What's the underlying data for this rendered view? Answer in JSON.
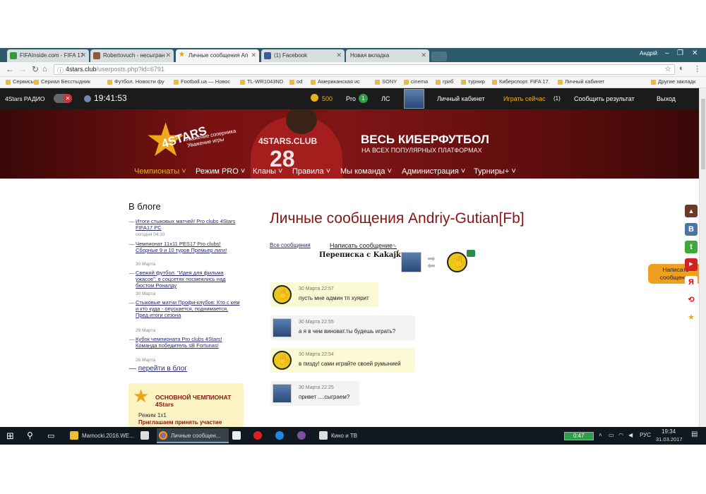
{
  "browser": {
    "tabs": [
      {
        "label": "FIFAInside.com - FIFA 17",
        "active": false
      },
      {
        "label": "Robertovuch - несыгран",
        "active": false
      },
      {
        "label": "Личные сообщения Ап",
        "active": true
      },
      {
        "label": "(1) Facebook",
        "active": false
      },
      {
        "label": "Новая вкладка",
        "active": false
      }
    ],
    "profile": "Андрій",
    "url_host": "4stars.club",
    "url_path": "/userposts.php?id=6791",
    "bookmarks": [
      "Сервисы",
      "Сериал Бесстыдник",
      "Футбол. Новости фу",
      "Football.ua — Новос",
      "TL-WR1043ND",
      "od",
      "Американская ис",
      "SONY",
      "cinema",
      "гриб",
      "турнир",
      "Киберспорт. FIFA 17.",
      "Личный кабинет",
      "Другие закладк"
    ]
  },
  "sitebar": {
    "radio": "4Stars РАДИО",
    "time": "19:41:53",
    "coins": "500",
    "pro_label": "Pro",
    "pro_count": "1",
    "ls": "ЛС",
    "cabinet": "Личный кабинет",
    "play_now": "Играть сейчас",
    "play_now_count": "(1)",
    "report": "Сообщить результат",
    "exit": "Выход"
  },
  "hero": {
    "logo_text": "4STARS",
    "logo_sub1": "Уважение соперника",
    "logo_sub2": "Уважение игры",
    "jersey_text": "4STARS.CLUB",
    "jersey_number": "28",
    "headline": "ВЕСЬ КИБЕРФУТБОЛ",
    "subheadline": "НА ВСЕХ ПОПУЛЯРНЫХ ПЛАТФОРМАХ"
  },
  "menu": [
    {
      "label": "Чемпионаты",
      "active": true
    },
    {
      "label": "Режим PRO",
      "active": false
    },
    {
      "label": "Кланы",
      "active": false
    },
    {
      "label": "Правила",
      "active": false
    },
    {
      "label": "Мы команда",
      "active": false
    },
    {
      "label": "Администрация",
      "active": false
    },
    {
      "label": "Турниры+",
      "active": false
    }
  ],
  "sidebar": {
    "title": "В блоге",
    "items": [
      {
        "title": "Итоги стыковых матчей! Pro clubs 4Stars FIFA17 PC",
        "date": "сегодня 04:10"
      },
      {
        "title": "Чемпионат 11х11 PES17 Pro clubs! Сборные 9 и 10 туров Премьер лиги!",
        "date": "30 Марта"
      },
      {
        "title": "Свежий футбол. \"Идея для фильма ужасов\": в соцсетях посмеялись над бюстом Роналду",
        "date": "30 Марта"
      },
      {
        "title": "Стыковые матчи Профи-клубов: Кто с кем и кто куда - опускается, поднимается. Пред итоги сезона",
        "date": "29 Марта"
      },
      {
        "title": "Кубок чемпионата Pro clubs 4Stars! Команда победитель sB Fortunas!",
        "date": "26 Марта"
      }
    ],
    "more": "перейти в блог",
    "champ_title": "ОСНОВНОЙ ЧЕМПИОНАТ 4Stars",
    "champ_mode": "Режим 1х1",
    "champ_invite": "Приглашаем принять участие"
  },
  "main": {
    "title": "Личные сообщения Andriy-Gutian[Fb]",
    "tab_all": "Все сообщения",
    "tab_write": "Написать сообщение",
    "thread_label": "Переписка с Kakajke",
    "messages": [
      {
        "date": "30 Марта 22:57",
        "text": "пусть мне админ тп хуярит",
        "side": "other"
      },
      {
        "date": "30 Марта 22:55",
        "text": "а я в чем виноват.ты будешь играть?",
        "side": "me"
      },
      {
        "date": "30 Марта 22:54",
        "text": "в пизду! сами играйте своей румынией",
        "side": "other"
      },
      {
        "date": "30 Марта 22:25",
        "text": "привет ....сыграем?",
        "side": "me"
      }
    ],
    "float_write": "Написать сообщение"
  },
  "taskbar": {
    "apps": [
      {
        "label": "Mamocki.2016.WE...",
        "active": false
      },
      {
        "label": "",
        "active": false
      },
      {
        "label": "Личные сообщен...",
        "active": true
      },
      {
        "label": "",
        "active": false
      },
      {
        "label": "",
        "active": false
      },
      {
        "label": "",
        "active": false
      },
      {
        "label": "",
        "active": false
      },
      {
        "label": "Кино и ТВ",
        "active": false
      }
    ],
    "media_time": "0:47",
    "lang": "РУС",
    "clock_time": "19:34",
    "clock_date": "31.03.2017"
  }
}
